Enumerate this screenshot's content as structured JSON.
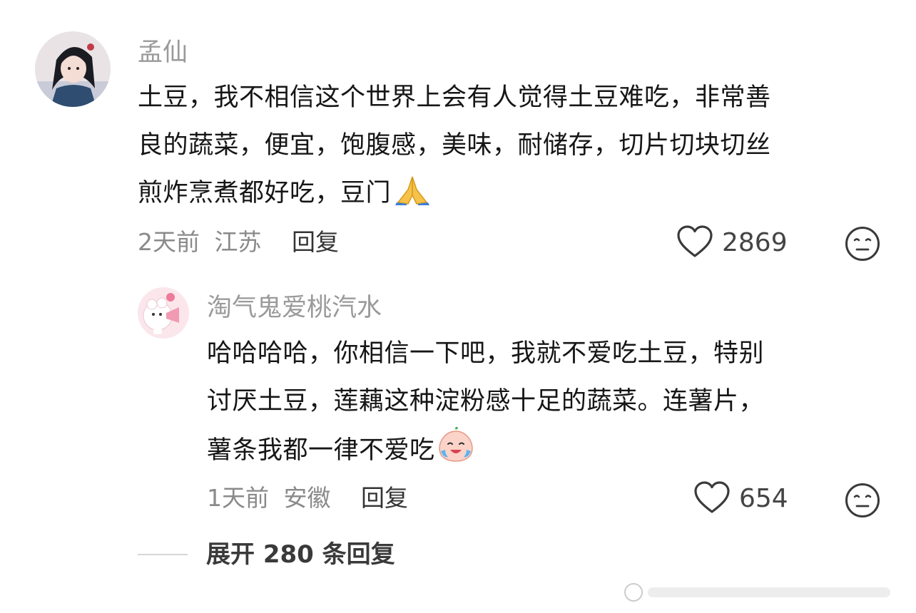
{
  "comment": {
    "username": "孟仙",
    "content_lines": [
      "土豆，我不相信这个世界上会有人觉得土豆难吃，非常善",
      "良的蔬菜，便宜，饱腹感，美味，耐储存，切片切块切丝",
      "煎炸烹煮都好吃，豆门"
    ],
    "time": "2天前",
    "location": "江苏",
    "reply_label": "回复",
    "like_count": "2869"
  },
  "reply": {
    "username": "淘气鬼爱桃汽水",
    "content_lines": [
      "哈哈哈哈，你相信一下吧，我就不爱吃土豆，特别",
      "讨厌土豆，莲藕这种淀粉感十足的蔬菜。连薯片，",
      "薯条我都一律不爱吃"
    ],
    "time": "1天前",
    "location": "安徽",
    "reply_label": "回复",
    "like_count": "654"
  },
  "expand": {
    "label": "展开 280 条回复"
  },
  "icons": {
    "heart": "heart-outline-icon",
    "dislike": "neutral-face-icon",
    "pray": "folded-hands-emoji",
    "cry": "crying-laughing-peach-emoji"
  },
  "colors": {
    "username": "#9a9a9a",
    "text": "#161616",
    "meta": "#8a8a8a",
    "reply": "#333333"
  }
}
